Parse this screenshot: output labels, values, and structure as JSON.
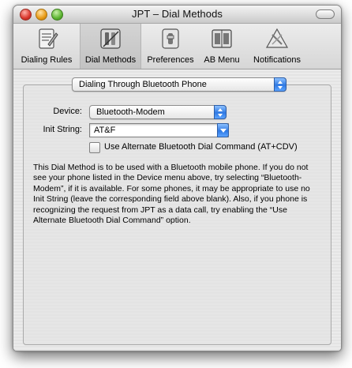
{
  "window": {
    "title": "JPT – Dial Methods"
  },
  "toolbar": {
    "items": [
      {
        "label": "Dialing Rules",
        "icon": "dialing-rules-icon",
        "selected": false
      },
      {
        "label": "Dial Methods",
        "icon": "dial-methods-icon",
        "selected": true
      },
      {
        "label": "Preferences",
        "icon": "preferences-icon",
        "selected": false
      },
      {
        "label": "AB Menu",
        "icon": "address-book-menu-icon",
        "selected": false
      },
      {
        "label": "Notifications",
        "icon": "notifications-icon",
        "selected": false
      }
    ]
  },
  "method": {
    "selected": "Dialing Through Bluetooth Phone"
  },
  "form": {
    "device_label": "Device:",
    "device_value": "Bluetooth-Modem",
    "init_label": "Init String:",
    "init_value": "AT&F",
    "alt_command_label": "Use Alternate Bluetooth Dial Command (AT+CDV)",
    "alt_command_checked": false
  },
  "description": "This Dial Method is to be used with a Bluetooth mobile phone. If you do not see your phone listed in the Device menu above, try selecting “Bluetooth-Modem”, if it is available. For some phones, it may be appropriate to use no Init String (leave the corresponding field above blank). Also, if you phone is recognizing the request from JPT as a data call, try enabling the “Use Alternate Bluetooth Dial Command” option.",
  "colors": {
    "accent": "#2f79e3",
    "window_bg": "#e9e9e9"
  }
}
